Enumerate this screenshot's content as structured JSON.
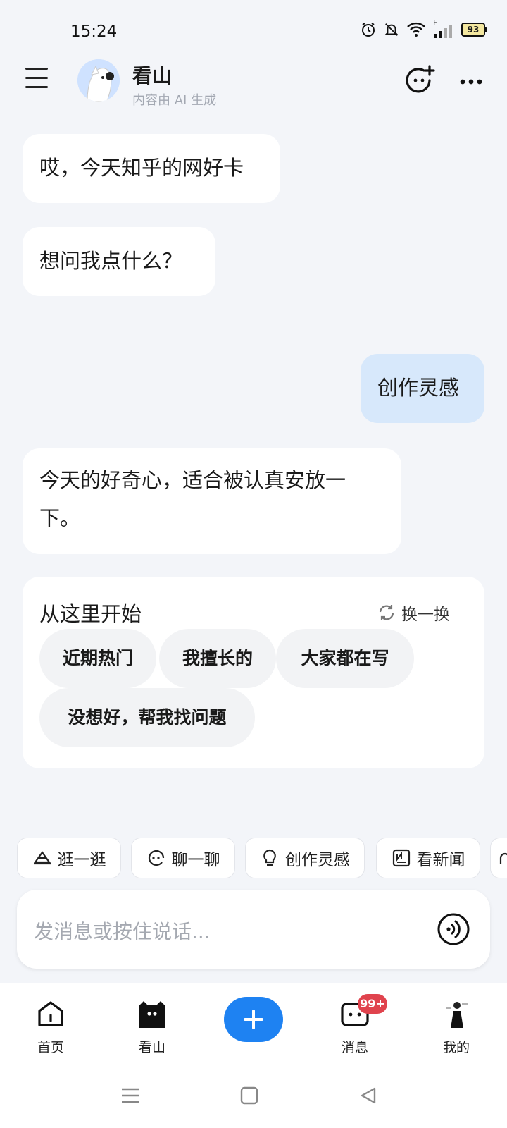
{
  "status_bar": {
    "time": "15:24",
    "network_label": "E",
    "battery_level": "93"
  },
  "header": {
    "bot_name": "看山",
    "bot_subtitle": "内容由 AI 生成"
  },
  "messages": [
    {
      "role": "bot",
      "text": "哎，今天知乎的网好卡"
    },
    {
      "role": "bot",
      "text": "想问我点什么？"
    },
    {
      "role": "user",
      "text": "创作灵感"
    },
    {
      "role": "bot",
      "text": "今天的好奇心，适合被认真安放一下。"
    }
  ],
  "start_card": {
    "title": "从这里开始",
    "refresh_label": "换一换",
    "chips": [
      "近期热门",
      "我擅长的",
      "大家都在写",
      "没想好，帮我找问题"
    ]
  },
  "quick_actions": [
    {
      "label": "逛一逛",
      "icon": "hat-icon"
    },
    {
      "label": "聊一聊",
      "icon": "chat-face-icon"
    },
    {
      "label": "创作灵感",
      "icon": "lightbulb-icon"
    },
    {
      "label": "看新闻",
      "icon": "newspaper-icon"
    }
  ],
  "input": {
    "placeholder": "发消息或按住说话..."
  },
  "bottom_nav": {
    "items": [
      {
        "label": "首页",
        "icon": "home-icon"
      },
      {
        "label": "看山",
        "icon": "kanshan-icon"
      },
      {
        "label": "",
        "icon": "plus-icon"
      },
      {
        "label": "消息",
        "icon": "message-icon",
        "badge": "99+"
      },
      {
        "label": "我的",
        "icon": "profile-avatar-icon"
      }
    ]
  },
  "colors": {
    "accent": "#1e82f2",
    "user_bubble": "#d7e8fb",
    "badge": "#e0434d",
    "background": "#f3f5f9"
  }
}
